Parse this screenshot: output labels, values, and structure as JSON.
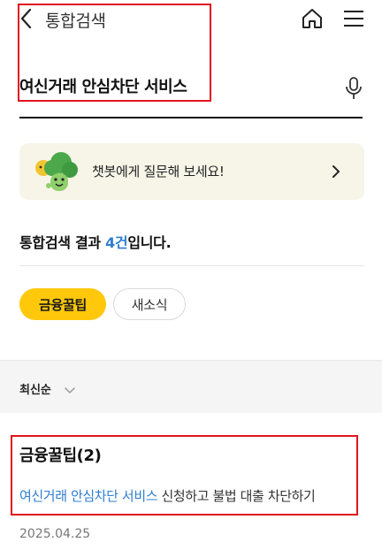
{
  "header": {
    "title": "통합검색"
  },
  "search": {
    "query": "여신거래 안심차단 서비스"
  },
  "chatbot": {
    "prompt": "챗봇에게 질문해 보세요!"
  },
  "results": {
    "prefix": "통합검색 결과 ",
    "count": "4건",
    "suffix": "입니다."
  },
  "tabs": [
    {
      "label": "금융꿀팁",
      "active": true
    },
    {
      "label": "새소식",
      "active": false
    }
  ],
  "sort": {
    "label": "최신순"
  },
  "section": {
    "title": "금융꿀팁(2)",
    "item": {
      "highlight": "여신거래 안심차단 서비스",
      "rest": " 신청하고 불법 대출 차단하기",
      "date": "2025.04.25"
    }
  },
  "colors": {
    "accent_yellow": "#ffc80a",
    "link_blue": "#2f7dd1",
    "annotation_red": "#e0141e"
  }
}
